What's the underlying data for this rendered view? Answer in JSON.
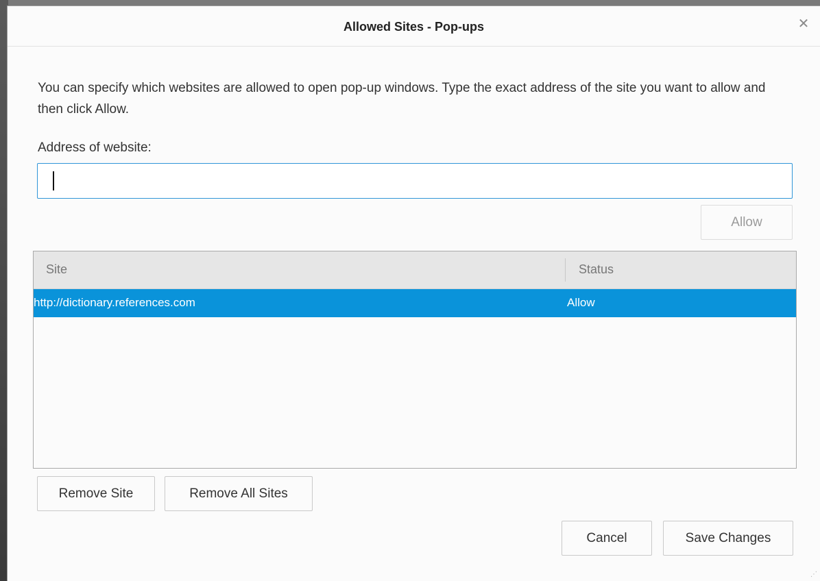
{
  "dialog": {
    "title": "Allowed Sites - Pop-ups",
    "description": "You can specify which websites are allowed to open pop-up windows. Type the exact address of the site you want to allow and then click Allow.",
    "address_label": "Address of website:",
    "address_value": "",
    "allow_label": "Allow",
    "close_icon": "close-icon"
  },
  "table": {
    "columns": [
      "Site",
      "Status"
    ],
    "rows": [
      {
        "site": "http://dictionary.references.com",
        "status": "Allow",
        "selected": true
      }
    ],
    "selection_color": "#0a93da"
  },
  "buttons": {
    "remove_site": "Remove Site",
    "remove_all_sites": "Remove All Sites",
    "cancel": "Cancel",
    "save_changes": "Save Changes"
  },
  "colors": {
    "focus_border": "#2f95d8",
    "dialog_background": "#fbfbfb"
  }
}
